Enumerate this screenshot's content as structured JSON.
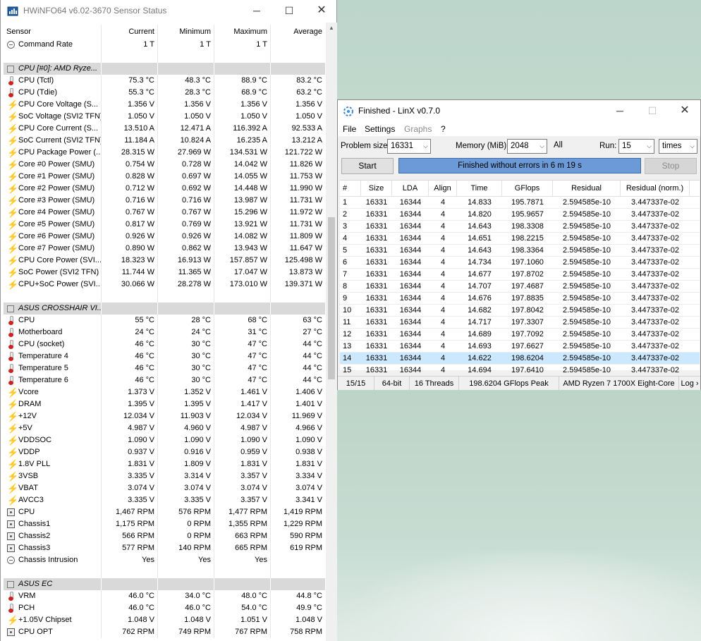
{
  "hwinfo": {
    "title": "HWiNFO64 v6.02-3670 Sensor Status",
    "columns": [
      "Sensor",
      "Current",
      "Minimum",
      "Maximum",
      "Average"
    ],
    "rows": [
      {
        "type": "sensor",
        "icon": "clock",
        "name": "Command Rate",
        "cur": "1 T",
        "min": "1 T",
        "max": "1 T",
        "avg": ""
      },
      {
        "type": "blank"
      },
      {
        "type": "group",
        "icon": "cpu",
        "name": "CPU [#0]: AMD Ryze..."
      },
      {
        "type": "sensor",
        "icon": "thermo",
        "name": "CPU (Tctl)",
        "cur": "75.3 °C",
        "min": "48.3 °C",
        "max": "88.9 °C",
        "avg": "83.2 °C"
      },
      {
        "type": "sensor",
        "icon": "thermo",
        "name": "CPU (Tdie)",
        "cur": "55.3 °C",
        "min": "28.3 °C",
        "max": "68.9 °C",
        "avg": "63.2 °C"
      },
      {
        "type": "sensor",
        "icon": "bolt",
        "name": "CPU Core Voltage (S...",
        "cur": "1.356 V",
        "min": "1.356 V",
        "max": "1.356 V",
        "avg": "1.356 V"
      },
      {
        "type": "sensor",
        "icon": "bolt",
        "name": "SoC Voltage (SVI2 TFN)",
        "cur": "1.050 V",
        "min": "1.050 V",
        "max": "1.050 V",
        "avg": "1.050 V"
      },
      {
        "type": "sensor",
        "icon": "bolt",
        "name": "CPU Core Current (S...",
        "cur": "13.510 A",
        "min": "12.471 A",
        "max": "116.392 A",
        "avg": "92.533 A"
      },
      {
        "type": "sensor",
        "icon": "bolt",
        "name": "SoC Current (SVI2 TFN)",
        "cur": "11.184 A",
        "min": "10.824 A",
        "max": "16.235 A",
        "avg": "13.212 A"
      },
      {
        "type": "sensor",
        "icon": "bolt",
        "name": "CPU Package Power (...",
        "cur": "28.315 W",
        "min": "27.969 W",
        "max": "134.531 W",
        "avg": "121.722 W"
      },
      {
        "type": "sensor",
        "icon": "bolt",
        "name": "Core #0 Power (SMU)",
        "cur": "0.754 W",
        "min": "0.728 W",
        "max": "14.042 W",
        "avg": "11.826 W"
      },
      {
        "type": "sensor",
        "icon": "bolt",
        "name": "Core #1 Power (SMU)",
        "cur": "0.828 W",
        "min": "0.697 W",
        "max": "14.055 W",
        "avg": "11.753 W"
      },
      {
        "type": "sensor",
        "icon": "bolt",
        "name": "Core #2 Power (SMU)",
        "cur": "0.712 W",
        "min": "0.692 W",
        "max": "14.448 W",
        "avg": "11.990 W"
      },
      {
        "type": "sensor",
        "icon": "bolt",
        "name": "Core #3 Power (SMU)",
        "cur": "0.716 W",
        "min": "0.716 W",
        "max": "13.987 W",
        "avg": "11.731 W"
      },
      {
        "type": "sensor",
        "icon": "bolt",
        "name": "Core #4 Power (SMU)",
        "cur": "0.767 W",
        "min": "0.767 W",
        "max": "15.296 W",
        "avg": "11.972 W"
      },
      {
        "type": "sensor",
        "icon": "bolt",
        "name": "Core #5 Power (SMU)",
        "cur": "0.817 W",
        "min": "0.769 W",
        "max": "13.921 W",
        "avg": "11.731 W"
      },
      {
        "type": "sensor",
        "icon": "bolt",
        "name": "Core #6 Power (SMU)",
        "cur": "0.926 W",
        "min": "0.926 W",
        "max": "14.082 W",
        "avg": "11.809 W"
      },
      {
        "type": "sensor",
        "icon": "bolt",
        "name": "Core #7 Power (SMU)",
        "cur": "0.890 W",
        "min": "0.862 W",
        "max": "13.943 W",
        "avg": "11.647 W"
      },
      {
        "type": "sensor",
        "icon": "bolt",
        "name": "CPU Core Power (SVI...",
        "cur": "18.323 W",
        "min": "16.913 W",
        "max": "157.857 W",
        "avg": "125.498 W"
      },
      {
        "type": "sensor",
        "icon": "bolt",
        "name": "SoC Power (SVI2 TFN)",
        "cur": "11.744 W",
        "min": "11.365 W",
        "max": "17.047 W",
        "avg": "13.873 W"
      },
      {
        "type": "sensor",
        "icon": "bolt",
        "name": "CPU+SoC Power (SVI...",
        "cur": "30.066 W",
        "min": "28.278 W",
        "max": "173.010 W",
        "avg": "139.371 W"
      },
      {
        "type": "blank"
      },
      {
        "type": "group",
        "icon": "cpu",
        "name": "ASUS CROSSHAIR VI..."
      },
      {
        "type": "sensor",
        "icon": "thermo",
        "name": "CPU",
        "cur": "55 °C",
        "min": "28 °C",
        "max": "68 °C",
        "avg": "63 °C"
      },
      {
        "type": "sensor",
        "icon": "thermo",
        "name": "Motherboard",
        "cur": "24 °C",
        "min": "24 °C",
        "max": "31 °C",
        "avg": "27 °C"
      },
      {
        "type": "sensor",
        "icon": "thermo",
        "name": "CPU (socket)",
        "cur": "46 °C",
        "min": "30 °C",
        "max": "47 °C",
        "avg": "44 °C"
      },
      {
        "type": "sensor",
        "icon": "thermo",
        "name": "Temperature 4",
        "cur": "46 °C",
        "min": "30 °C",
        "max": "47 °C",
        "avg": "44 °C"
      },
      {
        "type": "sensor",
        "icon": "thermo",
        "name": "Temperature 5",
        "cur": "46 °C",
        "min": "30 °C",
        "max": "47 °C",
        "avg": "44 °C"
      },
      {
        "type": "sensor",
        "icon": "thermo",
        "name": "Temperature 6",
        "cur": "46 °C",
        "min": "30 °C",
        "max": "47 °C",
        "avg": "44 °C"
      },
      {
        "type": "sensor",
        "icon": "bolt",
        "name": "Vcore",
        "cur": "1.373 V",
        "min": "1.352 V",
        "max": "1.461 V",
        "avg": "1.406 V"
      },
      {
        "type": "sensor",
        "icon": "bolt",
        "name": "DRAM",
        "cur": "1.395 V",
        "min": "1.395 V",
        "max": "1.417 V",
        "avg": "1.401 V"
      },
      {
        "type": "sensor",
        "icon": "bolt",
        "name": "+12V",
        "cur": "12.034 V",
        "min": "11.903 V",
        "max": "12.034 V",
        "avg": "11.969 V"
      },
      {
        "type": "sensor",
        "icon": "bolt",
        "name": "+5V",
        "cur": "4.987 V",
        "min": "4.960 V",
        "max": "4.987 V",
        "avg": "4.966 V"
      },
      {
        "type": "sensor",
        "icon": "bolt",
        "name": "VDDSOC",
        "cur": "1.090 V",
        "min": "1.090 V",
        "max": "1.090 V",
        "avg": "1.090 V"
      },
      {
        "type": "sensor",
        "icon": "bolt",
        "name": "VDDP",
        "cur": "0.937 V",
        "min": "0.916 V",
        "max": "0.959 V",
        "avg": "0.938 V"
      },
      {
        "type": "sensor",
        "icon": "bolt",
        "name": "1.8V PLL",
        "cur": "1.831 V",
        "min": "1.809 V",
        "max": "1.831 V",
        "avg": "1.831 V"
      },
      {
        "type": "sensor",
        "icon": "bolt",
        "name": "3VSB",
        "cur": "3.335 V",
        "min": "3.314 V",
        "max": "3.357 V",
        "avg": "3.334 V"
      },
      {
        "type": "sensor",
        "icon": "bolt",
        "name": "VBAT",
        "cur": "3.074 V",
        "min": "3.074 V",
        "max": "3.074 V",
        "avg": "3.074 V"
      },
      {
        "type": "sensor",
        "icon": "bolt",
        "name": "AVCC3",
        "cur": "3.335 V",
        "min": "3.335 V",
        "max": "3.357 V",
        "avg": "3.341 V"
      },
      {
        "type": "sensor",
        "icon": "fan",
        "name": "CPU",
        "cur": "1,467 RPM",
        "min": "576 RPM",
        "max": "1,477 RPM",
        "avg": "1,419 RPM"
      },
      {
        "type": "sensor",
        "icon": "fan",
        "name": "Chassis1",
        "cur": "1,175 RPM",
        "min": "0 RPM",
        "max": "1,355 RPM",
        "avg": "1,229 RPM"
      },
      {
        "type": "sensor",
        "icon": "fan",
        "name": "Chassis2",
        "cur": "566 RPM",
        "min": "0 RPM",
        "max": "663 RPM",
        "avg": "590 RPM"
      },
      {
        "type": "sensor",
        "icon": "fan",
        "name": "Chassis3",
        "cur": "577 RPM",
        "min": "140 RPM",
        "max": "665 RPM",
        "avg": "619 RPM"
      },
      {
        "type": "sensor",
        "icon": "clock",
        "name": "Chassis Intrusion",
        "cur": "Yes",
        "min": "Yes",
        "max": "Yes",
        "avg": ""
      },
      {
        "type": "blank"
      },
      {
        "type": "group",
        "icon": "cpu",
        "name": "ASUS EC"
      },
      {
        "type": "sensor",
        "icon": "thermo",
        "name": "VRM",
        "cur": "46.0 °C",
        "min": "34.0 °C",
        "max": "48.0 °C",
        "avg": "44.8 °C"
      },
      {
        "type": "sensor",
        "icon": "thermo",
        "name": "PCH",
        "cur": "46.0 °C",
        "min": "46.0 °C",
        "max": "54.0 °C",
        "avg": "49.9 °C"
      },
      {
        "type": "sensor",
        "icon": "bolt",
        "name": "+1.05V Chipset",
        "cur": "1.048 V",
        "min": "1.048 V",
        "max": "1.051 V",
        "avg": "1.048 V"
      },
      {
        "type": "sensor",
        "icon": "fan",
        "name": "CPU OPT",
        "cur": "762 RPM",
        "min": "749 RPM",
        "max": "767 RPM",
        "avg": "758 RPM"
      }
    ]
  },
  "linx": {
    "title": "Finished - LinX v0.7.0",
    "menu": {
      "file": "File",
      "settings": "Settings",
      "graphs": "Graphs",
      "help": "?"
    },
    "problem_size_label": "Problem size:",
    "problem_size_value": "16331",
    "memory_label": "Memory (MiB):",
    "memory_value": "2048",
    "all_label": "All",
    "run_label": "Run:",
    "run_value": "15",
    "run_unit": "times",
    "start_label": "Start",
    "stop_label": "Stop",
    "progress_text": "Finished without errors in 6 m 19 s",
    "progress_fraction": 1.0,
    "columns": [
      "#",
      "Size",
      "LDA",
      "Align",
      "Time",
      "GFlops",
      "Residual",
      "Residual (norm.)"
    ],
    "rows": [
      [
        "1",
        "16331",
        "16344",
        "4",
        "14.833",
        "195.7871",
        "2.594585e-10",
        "3.447337e-02"
      ],
      [
        "2",
        "16331",
        "16344",
        "4",
        "14.820",
        "195.9657",
        "2.594585e-10",
        "3.447337e-02"
      ],
      [
        "3",
        "16331",
        "16344",
        "4",
        "14.643",
        "198.3308",
        "2.594585e-10",
        "3.447337e-02"
      ],
      [
        "4",
        "16331",
        "16344",
        "4",
        "14.651",
        "198.2215",
        "2.594585e-10",
        "3.447337e-02"
      ],
      [
        "5",
        "16331",
        "16344",
        "4",
        "14.643",
        "198.3364",
        "2.594585e-10",
        "3.447337e-02"
      ],
      [
        "6",
        "16331",
        "16344",
        "4",
        "14.734",
        "197.1060",
        "2.594585e-10",
        "3.447337e-02"
      ],
      [
        "7",
        "16331",
        "16344",
        "4",
        "14.677",
        "197.8702",
        "2.594585e-10",
        "3.447337e-02"
      ],
      [
        "8",
        "16331",
        "16344",
        "4",
        "14.707",
        "197.4687",
        "2.594585e-10",
        "3.447337e-02"
      ],
      [
        "9",
        "16331",
        "16344",
        "4",
        "14.676",
        "197.8835",
        "2.594585e-10",
        "3.447337e-02"
      ],
      [
        "10",
        "16331",
        "16344",
        "4",
        "14.682",
        "197.8042",
        "2.594585e-10",
        "3.447337e-02"
      ],
      [
        "11",
        "16331",
        "16344",
        "4",
        "14.717",
        "197.3307",
        "2.594585e-10",
        "3.447337e-02"
      ],
      [
        "12",
        "16331",
        "16344",
        "4",
        "14.689",
        "197.7092",
        "2.594585e-10",
        "3.447337e-02"
      ],
      [
        "13",
        "16331",
        "16344",
        "4",
        "14.693",
        "197.6627",
        "2.594585e-10",
        "3.447337e-02"
      ],
      [
        "14",
        "16331",
        "16344",
        "4",
        "14.622",
        "198.6204",
        "2.594585e-10",
        "3.447337e-02"
      ],
      [
        "15",
        "16331",
        "16344",
        "4",
        "14.694",
        "197.6410",
        "2.594585e-10",
        "3.447337e-02"
      ]
    ],
    "selected_row": "14",
    "status": {
      "runs": "15/15",
      "arch": "64-bit",
      "threads": "16 Threads",
      "peak": "198.6204 GFlops Peak",
      "cpu": "AMD Ryzen 7 1700X Eight-Core",
      "log": "Log ›"
    }
  },
  "colors": {
    "progress": "#6b9ad6",
    "selected_row": "#cce8ff",
    "group_row": "#d9d9d9",
    "bolt": "#e8b400",
    "thermo": "#d02020"
  }
}
